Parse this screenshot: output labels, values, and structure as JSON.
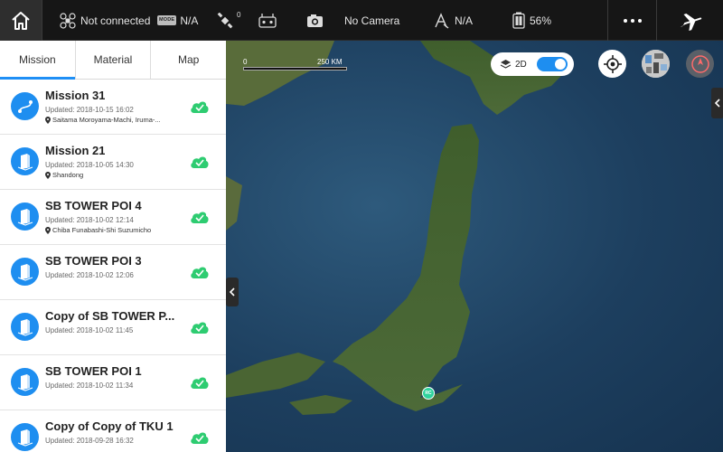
{
  "topbar": {
    "connection_status": "Not connected",
    "mode_badge": "MODE",
    "mode_value": "N/A",
    "gps_count": "0",
    "camera_status": "No Camera",
    "obstacle_value": "N/A",
    "battery_percent": "56%"
  },
  "tabs": [
    {
      "label": "Mission",
      "active": true
    },
    {
      "label": "Material",
      "active": false
    },
    {
      "label": "Map",
      "active": false
    }
  ],
  "missions": [
    {
      "name": "Mission 31",
      "updated": "Updated: 2018-10-15 16:02",
      "location": "Saitama Moroyama-Machi, Iruma-...",
      "icon": "route-icon"
    },
    {
      "name": "Mission 21",
      "updated": "Updated: 2018-10-05 14:30",
      "location": "Shandong",
      "icon": "building-icon"
    },
    {
      "name": "SB TOWER POI 4",
      "updated": "Updated: 2018-10-02 12:14",
      "location": "Chiba Funabashi-Shi Suzumicho",
      "icon": "building-icon"
    },
    {
      "name": "SB TOWER POI 3",
      "updated": "Updated: 2018-10-02 12:06",
      "location": "",
      "icon": "building-icon"
    },
    {
      "name": "Copy of SB TOWER P...",
      "updated": "Updated: 2018-10-02 11:45",
      "location": "",
      "icon": "building-icon"
    },
    {
      "name": "SB TOWER POI 1",
      "updated": "Updated: 2018-10-02 11:34",
      "location": "",
      "icon": "building-icon"
    },
    {
      "name": "Copy of Copy of TKU 1",
      "updated": "Updated: 2018-09-28 16:32",
      "location": "",
      "icon": "building-icon"
    }
  ],
  "map": {
    "scale_zero": "0",
    "scale_label": "250 KM",
    "view_toggle_label": "2D",
    "rc_marker": "RC"
  },
  "colors": {
    "accent": "#1e8ef0",
    "cloud_synced": "#2ecc71",
    "rc_marker": "#2fd39c"
  }
}
